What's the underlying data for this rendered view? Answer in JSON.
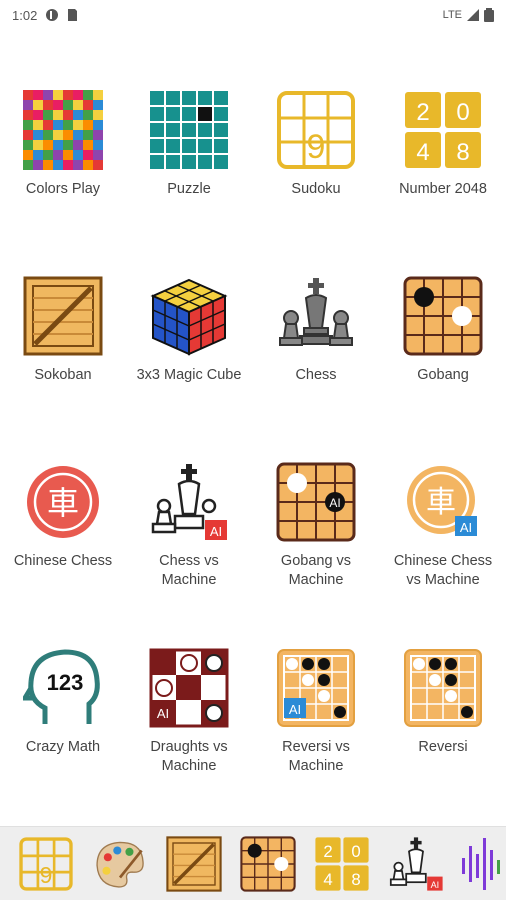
{
  "status": {
    "time": "1:02",
    "network": "LTE"
  },
  "apps": [
    {
      "id": "colors-play",
      "label": "Colors Play",
      "icon": "colors-grid-icon"
    },
    {
      "id": "puzzle",
      "label": "Puzzle",
      "icon": "puzzle-grid-icon"
    },
    {
      "id": "sudoku",
      "label": "Sudoku",
      "icon": "sudoku-icon",
      "digit": "9"
    },
    {
      "id": "number-2048",
      "label": "Number 2048",
      "icon": "number-2048-icon",
      "digits": [
        "2",
        "0",
        "4",
        "8"
      ]
    },
    {
      "id": "sokoban",
      "label": "Sokoban",
      "icon": "crate-icon"
    },
    {
      "id": "magic-cube",
      "label": "3x3 Magic Cube",
      "icon": "rubiks-cube-icon"
    },
    {
      "id": "chess",
      "label": "Chess",
      "icon": "chess-pieces-icon"
    },
    {
      "id": "gobang",
      "label": "Gobang",
      "icon": "gobang-board-icon"
    },
    {
      "id": "chinese-chess",
      "label": "Chinese Chess",
      "icon": "chinese-chess-icon",
      "glyph": "車"
    },
    {
      "id": "chess-vs-machine",
      "label": "Chess vs Machine",
      "icon": "chess-ai-icon",
      "badge": "AI"
    },
    {
      "id": "gobang-vs-machine",
      "label": "Gobang vs Machine",
      "icon": "gobang-ai-icon",
      "badge": "AI"
    },
    {
      "id": "chinese-chess-vs-machine",
      "label": "Chinese Chess vs Machine",
      "icon": "chinese-chess-ai-icon",
      "glyph": "車",
      "badge": "AI"
    },
    {
      "id": "crazy-math",
      "label": "Crazy Math",
      "icon": "head-123-icon",
      "text": "123"
    },
    {
      "id": "draughts-vs-machine",
      "label": "Draughts vs Machine",
      "icon": "draughts-ai-icon",
      "badge": "AI"
    },
    {
      "id": "reversi-vs-machine",
      "label": "Reversi vs Machine",
      "icon": "reversi-ai-icon",
      "badge": "AI"
    },
    {
      "id": "reversi",
      "label": "Reversi",
      "icon": "reversi-icon"
    }
  ],
  "dock": [
    {
      "id": "dock-sudoku",
      "icon": "sudoku-icon",
      "digit": "9"
    },
    {
      "id": "dock-paint",
      "icon": "paint-palette-icon"
    },
    {
      "id": "dock-sokoban",
      "icon": "crate-icon"
    },
    {
      "id": "dock-gobang",
      "icon": "gobang-board-icon"
    },
    {
      "id": "dock-2048",
      "icon": "number-2048-icon",
      "digits": [
        "2",
        "0",
        "4",
        "8"
      ]
    },
    {
      "id": "dock-chess-ai",
      "icon": "chess-ai-icon",
      "badge": "AI"
    },
    {
      "id": "dock-sound",
      "icon": "sound-wave-icon"
    }
  ],
  "colors": {
    "yellow": "#e8b82a",
    "teal": "#17918e",
    "wood": "#f0b860",
    "board_orange": "#f3b562",
    "red": "#e53935",
    "blue": "#2b8bd6",
    "maroon": "#7b1b1b"
  }
}
